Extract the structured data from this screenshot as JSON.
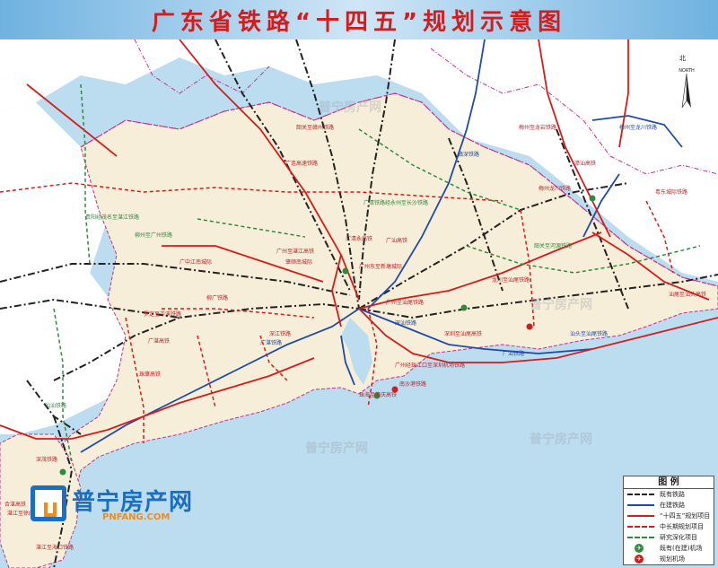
{
  "title": "广东省铁路“十四五”规划示意图",
  "compass": {
    "label": "北",
    "sub": "NORTH"
  },
  "legend": {
    "title": "图 例",
    "items": [
      {
        "label": "既有铁路",
        "symbol": "existing-railway",
        "color": "#222222"
      },
      {
        "label": "在建铁路",
        "symbol": "under-construction",
        "color": "#1f4aa8"
      },
      {
        "label": "“十四五”规划项目",
        "symbol": "plan-14th",
        "color": "#d31d1d"
      },
      {
        "label": "中长期规划项目",
        "symbol": "long-term",
        "color": "#d31d1d"
      },
      {
        "label": "研究深化项目",
        "symbol": "research",
        "color": "#2e8b3d"
      },
      {
        "label": "既有(在建)机场",
        "symbol": "airport-existing",
        "color": "#2e8b3d"
      },
      {
        "label": "规划机场",
        "symbol": "airport-planned",
        "color": "#d31d1d"
      }
    ]
  },
  "watermark": {
    "name": "普宁房产网",
    "url": "PNFANG.COM"
  },
  "colors": {
    "land": "#f6eed8",
    "sea": "#bcdcef",
    "outside": "#ffffff",
    "border": "#c0328f",
    "existing": "#222222",
    "construction": "#1f4aa8",
    "plan": "#d31d1d",
    "research": "#2e8b3d"
  },
  "map_labels": {
    "red": [
      "韶关至赣州铁路",
      "广连高速铁路",
      "广清永高铁",
      "广州至湛江高铁",
      "肇顺南城际",
      "广中江南城际",
      "广州东至新塘城际",
      "梅州至龙岩铁路",
      "汕尾至汕头高铁",
      "广汕高铁",
      "粤东城际铁路",
      "罗定至岑溪铁路",
      "深江铁路",
      "广湛高铁",
      "珠肇高铁",
      "深茂铁路",
      "湛江至海口铁路",
      "广州至汕尾铁路",
      "龙川至汕尾铁路",
      "梅州龙川铁路",
      "漳汕高铁",
      "深圳至汕尾高铁",
      "珠海至肇庆高铁",
      "广州经珠江口至深圳机场铁路",
      "柳广铁路",
      "合湛高铁",
      "湛江至徐闻铁路",
      "南沙港铁路"
    ],
    "green": [
      "贵阳经茂名至湛江铁路",
      "广清铁路经永州至长沙铁路",
      "韶关至河源铁路",
      "柳州至广州铁路",
      "汕汕铁路"
    ],
    "blue": [
      "梅州至龙川铁路",
      "赣深铁路",
      "广汕铁路",
      "广湛铁路",
      "深汕铁路",
      "汕头至汕尾铁路"
    ],
    "watermark_faint": [
      "普宁房产网",
      "普宁房产网",
      "普宁房产网",
      "普宁房产网"
    ]
  }
}
